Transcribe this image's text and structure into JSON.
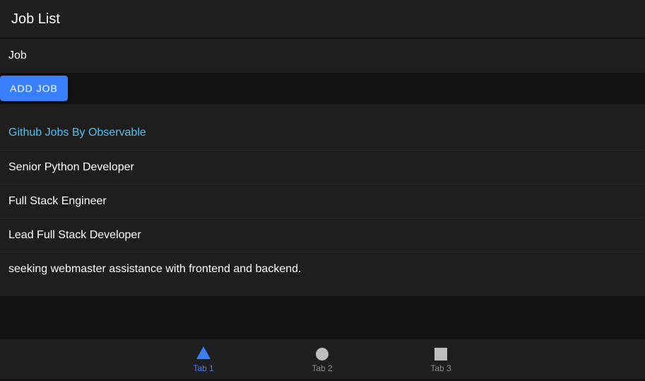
{
  "toolbar": {
    "title": "Job List"
  },
  "job_input": {
    "placeholder": "Job",
    "value": ""
  },
  "add_job_button": {
    "label": "ADD JOB"
  },
  "jobs_list": {
    "header": "Github Jobs By Observable",
    "items": [
      "Senior Python Developer",
      "Full Stack Engineer",
      "Lead Full Stack Developer",
      "seeking webmaster assistance with frontend and backend."
    ]
  },
  "tabs": [
    {
      "label": "Tab 1",
      "icon": "triangle-icon",
      "active": true
    },
    {
      "label": "Tab 2",
      "icon": "circle-icon",
      "active": false
    },
    {
      "label": "Tab 3",
      "icon": "square-icon",
      "active": false
    }
  ],
  "colors": {
    "primary": "#3880ff",
    "header_accent": "#4dc2f2",
    "background": "#121212",
    "surface": "#1e1e1e",
    "inactive_tab": "#8c8c8c"
  }
}
